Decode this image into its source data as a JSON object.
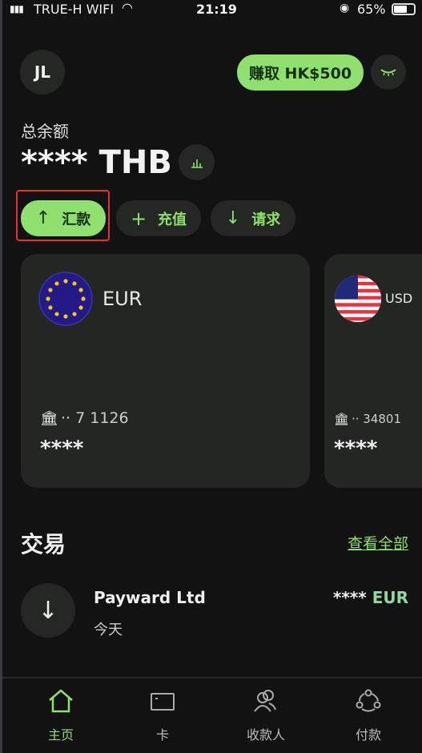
{
  "status_bar": {
    "carrier": "TRUE-H WIFI",
    "time": "21:19",
    "battery": "65%"
  },
  "header": {
    "avatar_initials": "JL",
    "earn_label": "赚取 HK$500"
  },
  "balance": {
    "label": "总余额",
    "amount": "**** THB"
  },
  "actions": [
    {
      "label": "汇款",
      "icon": "arrow-up-icon"
    },
    {
      "label": "充值",
      "icon": "plus-icon"
    },
    {
      "label": "请求",
      "icon": "arrow-down-icon"
    }
  ],
  "accounts": [
    {
      "currency": "EUR",
      "account": "·· 7 1126",
      "balance": "****",
      "flag": "eu-flag"
    },
    {
      "currency": "USD",
      "account": "·· 34801",
      "balance": "****",
      "flag": "us-flag"
    }
  ],
  "transactions": {
    "title": "交易",
    "view_all": "查看全部",
    "items": [
      {
        "name": "Payward Ltd",
        "date": "今天",
        "amount_masked": "****",
        "currency": "EUR"
      }
    ]
  },
  "nav": [
    {
      "label": "主页",
      "active": true
    },
    {
      "label": "卡"
    },
    {
      "label": "收款人"
    },
    {
      "label": "付款"
    }
  ],
  "colors": {
    "accent": "#8fe06f",
    "background": "#121212",
    "card": "#242624",
    "highlight": "#e8302a"
  }
}
